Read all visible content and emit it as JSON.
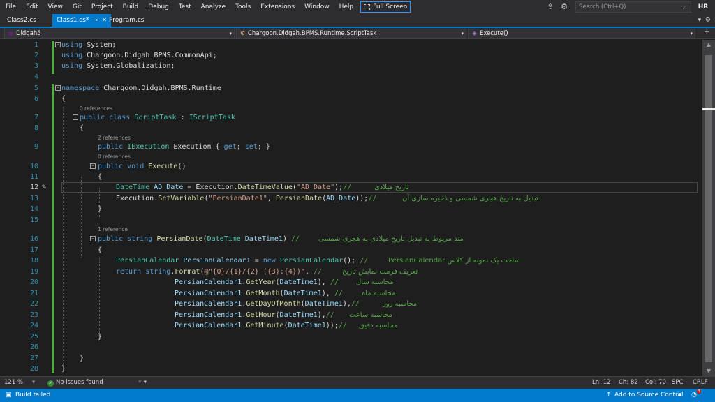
{
  "menu": {
    "items": [
      "File",
      "Edit",
      "View",
      "Git",
      "Project",
      "Build",
      "Debug",
      "Test",
      "Analyze",
      "Tools",
      "Extensions",
      "Window",
      "Help"
    ],
    "fullscreen_label": "Full Screen",
    "search_placeholder": "Search (Ctrl+Q)",
    "avatar": "HR"
  },
  "tabs": [
    {
      "label": "Class2.cs",
      "active": false
    },
    {
      "label": "Class1.cs*",
      "active": true
    },
    {
      "label": "Program.cs",
      "active": false
    }
  ],
  "navbar": {
    "project": "Didgah5",
    "class": "Chargoon.Didgah.BPMS.Runtime.ScriptTask",
    "member": "Execute()"
  },
  "editor": {
    "line_numbers": [
      "1",
      "2",
      "3",
      "4",
      "5",
      "6",
      "7",
      "8",
      "9",
      "10",
      "11",
      "12",
      "13",
      "14",
      "15",
      "16",
      "17",
      "18",
      "19",
      "20",
      "21",
      "22",
      "23",
      "24",
      "25",
      "26",
      "27",
      "28"
    ],
    "current_line": "12",
    "refs": {
      "before_7": "0 references",
      "before_9": "2 references",
      "before_10": "0 references",
      "before_16": "1 reference"
    },
    "comments": {
      "line12": "تاریخ میلادی",
      "line13": "تبدیل به تاریخ هجری شمسی و ذخیره سازی آن",
      "line16": "متد مربوط به تبدیل تاریخ میلادی به هجری شمسی",
      "line18": "ساخت یک نمونه از کلاس PersianCalendar",
      "line19": "تعریف فرمت نمایش تاریخ",
      "line20": "محاسبه سال",
      "line21": "محاسبه ماه",
      "line22": "محاسبه روز",
      "line23": "محاسبه ساعت",
      "line24": "محاسبه دقیق"
    }
  },
  "editor_status": {
    "zoom": "121 %",
    "issues": "No issues found",
    "line": "Ln: 12",
    "char": "Ch: 82",
    "col": "Col: 70",
    "spc": "SPC",
    "crlf": "CRLF"
  },
  "status": {
    "build": "Build failed",
    "source_control": "Add to Source Control",
    "notifications": "3"
  }
}
